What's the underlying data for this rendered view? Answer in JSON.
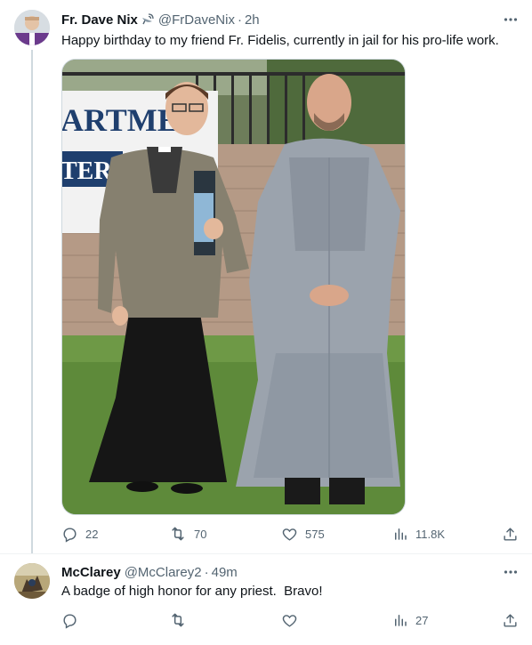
{
  "main_tweet": {
    "author_name": "Fr. Dave Nix",
    "handle": "@FrDaveNix",
    "separator": "·",
    "time": "2h",
    "text": "Happy birthday to my friend Fr. Fidelis, currently in jail for his pro-life work.",
    "photo_sign_line1": "ARTMEN",
    "photo_sign_line2": "TERS",
    "stats": {
      "replies": "22",
      "reposts": "70",
      "likes": "575",
      "views": "11.8K"
    }
  },
  "reply_tweet": {
    "author_name": "McClarey",
    "handle": "@McClarey2",
    "separator": "·",
    "time": "49m",
    "text": "A badge of high honor for any priest.  Bravo!",
    "stats": {
      "replies": "",
      "reposts": "",
      "likes": "",
      "views": "27"
    }
  },
  "icons": {
    "more": "more-horizontal-icon",
    "reply": "reply-bubble-icon",
    "repost": "repost-arrows-icon",
    "like": "heart-icon",
    "views": "bar-chart-icon",
    "share": "share-upload-icon",
    "badge": "satellite-dish-icon"
  },
  "colors": {
    "text_primary": "#0f1419",
    "text_secondary": "#536471",
    "thread_line": "#cfd9de"
  }
}
